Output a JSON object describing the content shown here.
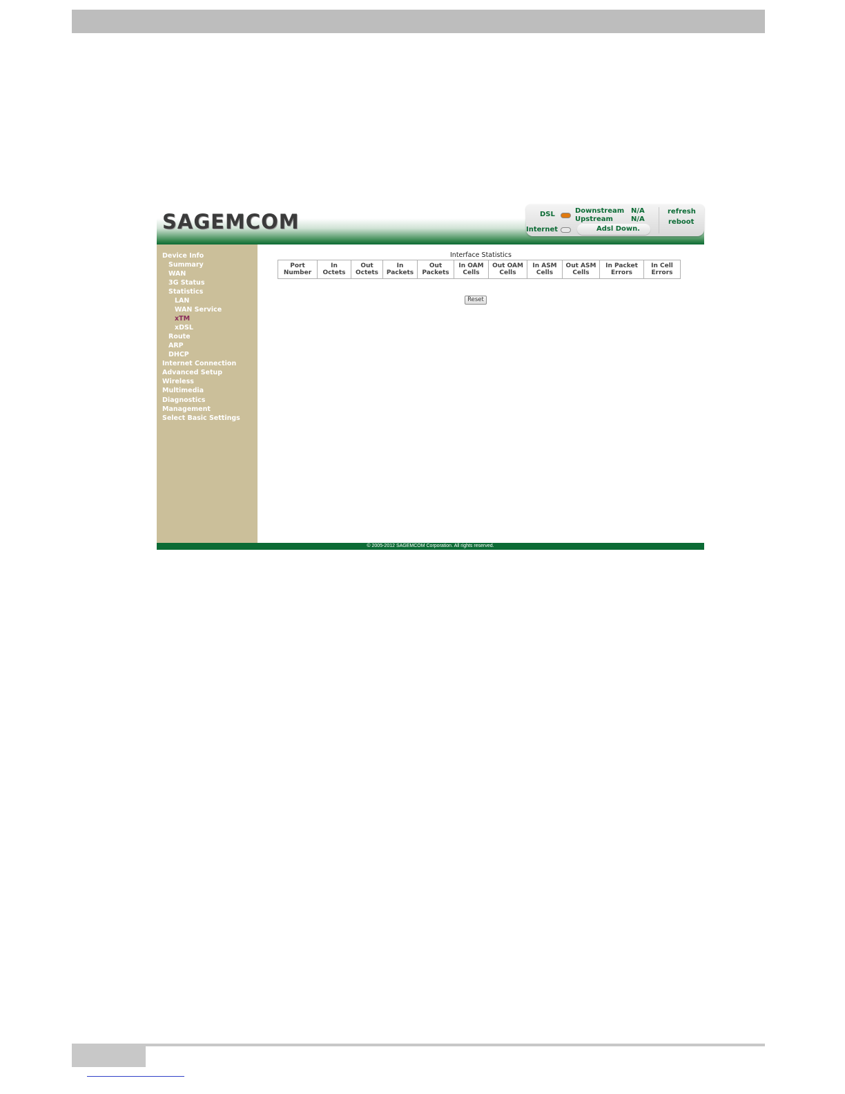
{
  "brand": {
    "logo_text": "SAGEMCOM"
  },
  "status": {
    "dsl_label": "DSL",
    "internet_label": "Internet",
    "downstream_label": "Downstream",
    "downstream_value": "N/A",
    "upstream_label": "Upstream",
    "upstream_value": "N/A",
    "adsl_status": "Adsl Down.",
    "refresh_label": "refresh",
    "reboot_label": "reboot",
    "dsl_led_color": "#e07a10",
    "internet_led_color": "#e8e8e8"
  },
  "sidebar": {
    "items": [
      {
        "label": "Device Info"
      },
      {
        "label": "Summary"
      },
      {
        "label": "WAN"
      },
      {
        "label": "3G Status"
      },
      {
        "label": "Statistics"
      },
      {
        "label": "LAN"
      },
      {
        "label": "WAN Service"
      },
      {
        "label": "xTM"
      },
      {
        "label": "xDSL"
      },
      {
        "label": "Route"
      },
      {
        "label": "ARP"
      },
      {
        "label": "DHCP"
      },
      {
        "label": "Internet Connection"
      },
      {
        "label": "Advanced Setup"
      },
      {
        "label": "Wireless"
      },
      {
        "label": "Multimedia"
      },
      {
        "label": "Diagnostics"
      },
      {
        "label": "Management"
      },
      {
        "label": "Select Basic Settings"
      }
    ],
    "active": "xTM"
  },
  "main": {
    "title": "Interface Statistics",
    "columns": [
      [
        "Port",
        "Number"
      ],
      [
        "In",
        "Octets"
      ],
      [
        "Out",
        "Octets"
      ],
      [
        "In",
        "Packets"
      ],
      [
        "Out",
        "Packets"
      ],
      [
        "In OAM",
        "Cells"
      ],
      [
        "Out OAM",
        "Cells"
      ],
      [
        "In ASM",
        "Cells"
      ],
      [
        "Out ASM",
        "Cells"
      ],
      [
        "In Packet",
        "Errors"
      ],
      [
        "In Cell",
        "Errors"
      ]
    ],
    "reset_label": "Reset"
  },
  "footer": {
    "copyright": "© 2005-2012 SAGEMCOM Corporation. All rights reserved."
  },
  "colors": {
    "brand_green": "#0c6b35",
    "sidebar_bg": "#cbbf9a",
    "active_link": "#8a2b5a"
  }
}
